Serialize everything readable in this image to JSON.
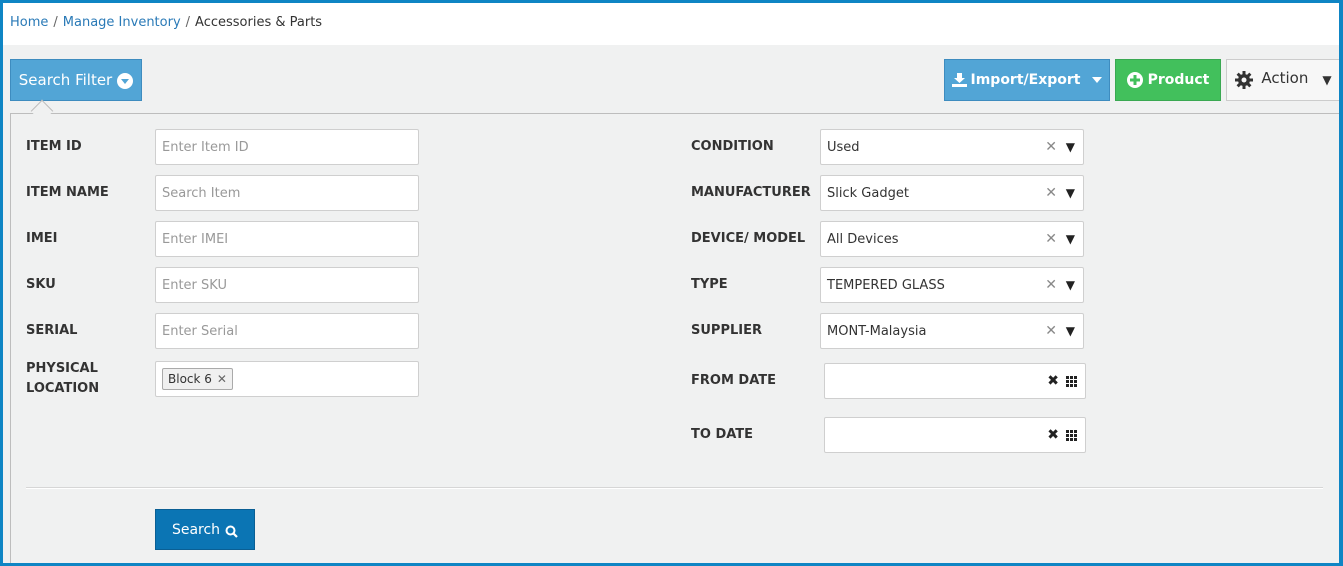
{
  "breadcrumb": {
    "items": [
      {
        "label": "Home",
        "link": true
      },
      {
        "label": "Manage Inventory",
        "link": true
      },
      {
        "label": "Accessories & Parts",
        "link": false
      }
    ],
    "separator": "/"
  },
  "toolbar": {
    "search_filter_label": "Search Filter",
    "import_export_label": "Import/Export",
    "product_label": "Product",
    "action_label": "Action"
  },
  "filters": {
    "left": [
      {
        "label": "ITEM ID",
        "placeholder": "Enter Item ID",
        "value": ""
      },
      {
        "label": "ITEM NAME",
        "placeholder": "Search Item",
        "value": ""
      },
      {
        "label": "IMEI",
        "placeholder": "Enter IMEI",
        "value": ""
      },
      {
        "label": "SKU",
        "placeholder": "Enter SKU",
        "value": ""
      },
      {
        "label": "SERIAL",
        "placeholder": "Enter Serial",
        "value": ""
      }
    ],
    "physical_location": {
      "label_line1": "PHYSICAL",
      "label_line2": "LOCATION",
      "tags": [
        "Block 6"
      ]
    },
    "right": [
      {
        "label": "CONDITION",
        "value": "Used"
      },
      {
        "label": "MANUFACTURER",
        "value": "Slick Gadget"
      },
      {
        "label": "DEVICE/ MODEL",
        "value": "All Devices"
      },
      {
        "label": "TYPE",
        "value": "TEMPERED GLASS"
      },
      {
        "label": "SUPPLIER",
        "value": "MONT-Malaysia"
      }
    ],
    "dates": [
      {
        "label": "FROM DATE",
        "value": ""
      },
      {
        "label": "TO DATE",
        "value": ""
      }
    ]
  },
  "search_button_label": "Search",
  "icons": {
    "clear": "✕",
    "dropdown": "▼",
    "date_clear": "✖"
  }
}
